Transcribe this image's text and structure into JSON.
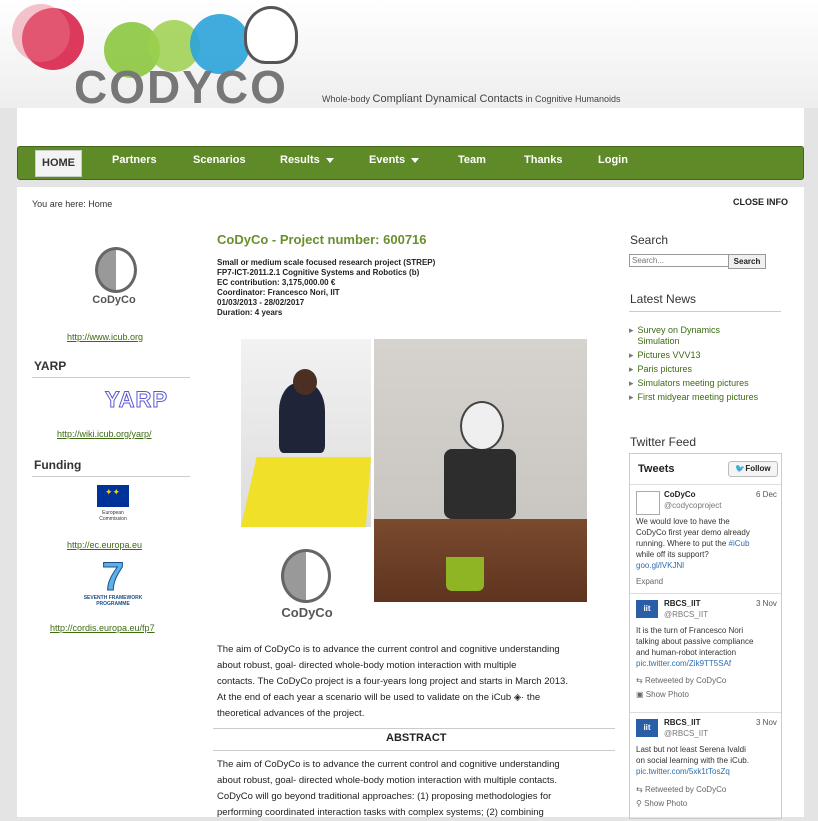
{
  "header": {
    "brand": "CODYCO",
    "tagline_prefix": "Whole-body",
    "tagline_main": "Compliant Dynamical Contacts",
    "tagline_suffix": "in Cognitive Humanoids"
  },
  "nav": {
    "home": "HOME",
    "partners": "Partners",
    "scenarios": "Scenarios",
    "results": "Results",
    "events": "Events",
    "team": "Team",
    "thanks": "Thanks",
    "login": "Login"
  },
  "breadcrumb": {
    "prefix": "You are here:",
    "current": "Home"
  },
  "close_info": "CLOSE INFO",
  "left": {
    "icub_link": "http://www.icub.org",
    "logo_text": "CoDyCo",
    "yarp_heading": "YARP",
    "yarp_logo_text": "YARP",
    "yarp_link": "http://wiki.icub.org/yarp/",
    "funding_heading": "Funding",
    "eu_caption_1": "European",
    "eu_caption_2": "Commission",
    "eu_link": "http://ec.europa.eu",
    "fp7_caption_1": "SEVENTH FRAMEWORK",
    "fp7_caption_2": "PROGRAMME",
    "fp7_link": "http://cordis.europa.eu/fp7"
  },
  "main": {
    "title": "CoDyCo - Project number: 600716",
    "info": [
      "Small or medium scale focused research project (STREP)",
      "FP7-ICT-2011.2.1 Cognitive Systems and Robotics (b)",
      "EC contribution:   3,175,000.00 €",
      "Coordinator: Francesco Nori, IIT",
      "01/03/2013 - 28/02/2017",
      "Duration: 4 years"
    ],
    "photo_logo_text": "CoDyCo",
    "intro": [
      "The aim of CoDyCo is to advance the current control and cognitive understanding",
      "about robust, goal- directed whole-body motion interaction with multiple",
      "contacts. The CoDyCo project is a four-years long project and starts in March 2013.",
      "At the end of each year a scenario will be used to validate on the iCub",
      "theoretical advances of the project."
    ],
    "abstract_heading": "ABSTRACT",
    "abstract": [
      "The aim of CoDyCo is to advance the current control and cognitive understanding",
      "about robust, goal- directed whole-body motion interaction with multiple contacts.",
      "CoDyCo will go beyond traditional approaches: (1) proposing methodologies for",
      "performing coordinated interaction tasks with complex systems; (2) combining"
    ]
  },
  "right": {
    "search_heading": "Search",
    "search_placeholder": "Search...",
    "search_button": "Search",
    "news_heading": "Latest News",
    "news": [
      "Survey on Dynamics Simulation",
      "Pictures VVV13",
      "Paris pictures",
      "Simulators meeting pictures",
      "First midyear meeting pictures"
    ],
    "twitter_heading": "Twitter Feed",
    "tweets_title": "Tweets",
    "follow": "Follow",
    "tweets": [
      {
        "name": "CoDyCo",
        "handle": "@codycoproject",
        "date": "6 Dec",
        "lines": [
          "We would love to have the",
          "CoDyCo first year demo already",
          "running. Where to put the",
          "while off its support?"
        ],
        "hashtag": "#iCub",
        "link": "goo.gl/lVKJNl",
        "action": "Expand"
      },
      {
        "name": "RBCS_IIT",
        "handle": "@RBCS_IIT",
        "date": "3 Nov",
        "lines": [
          "It is the turn of Francesco Nori",
          "talking about passive compliance",
          "and human-robot interaction"
        ],
        "link": "pic.twitter.com/Zik9TT5SAf",
        "retweet": "Retweeted by CoDyCo",
        "action": "Show Photo"
      },
      {
        "name": "RBCS_IIT",
        "handle": "@RBCS_IIT",
        "date": "3 Nov",
        "lines": [
          "Last but not least Serena Ivaldi",
          "on social learning with the iCub."
        ],
        "link": "pic.twitter.com/5xk1tTosZq",
        "retweet": "Retweeted by CoDyCo",
        "action": "Show Photo"
      }
    ]
  }
}
